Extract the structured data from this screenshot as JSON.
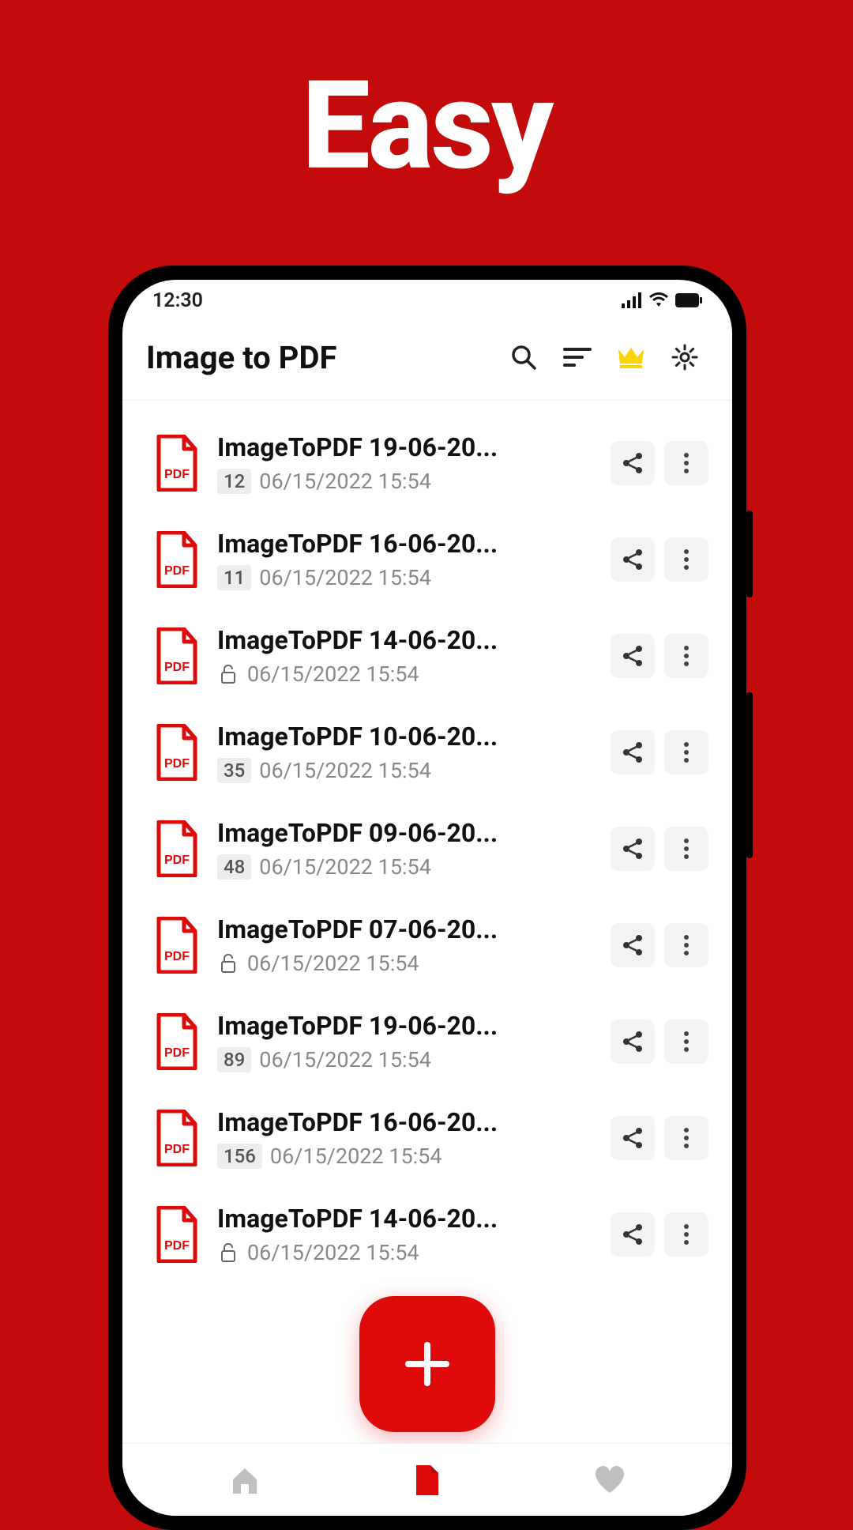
{
  "hero": {
    "title": "Easy"
  },
  "status": {
    "time": "12:30"
  },
  "header": {
    "title": "Image to PDF"
  },
  "files": [
    {
      "name": "ImageToPDF 19-06-20...",
      "badge": "12",
      "locked": false,
      "date": "06/15/2022 15:54"
    },
    {
      "name": "ImageToPDF 16-06-20...",
      "badge": "11",
      "locked": false,
      "date": "06/15/2022 15:54"
    },
    {
      "name": "ImageToPDF 14-06-20...",
      "badge": null,
      "locked": true,
      "date": "06/15/2022 15:54"
    },
    {
      "name": "ImageToPDF 10-06-20...",
      "badge": "35",
      "locked": false,
      "date": "06/15/2022 15:54"
    },
    {
      "name": "ImageToPDF 09-06-20...",
      "badge": "48",
      "locked": false,
      "date": "06/15/2022 15:54"
    },
    {
      "name": "ImageToPDF 07-06-20...",
      "badge": null,
      "locked": true,
      "date": "06/15/2022 15:54"
    },
    {
      "name": "ImageToPDF 19-06-20...",
      "badge": "89",
      "locked": false,
      "date": "06/15/2022 15:54"
    },
    {
      "name": "ImageToPDF 16-06-20...",
      "badge": "156",
      "locked": false,
      "date": "06/15/2022 15:54"
    },
    {
      "name": "ImageToPDF 14-06-20...",
      "badge": null,
      "locked": true,
      "date": "06/15/2022 15:54"
    }
  ]
}
